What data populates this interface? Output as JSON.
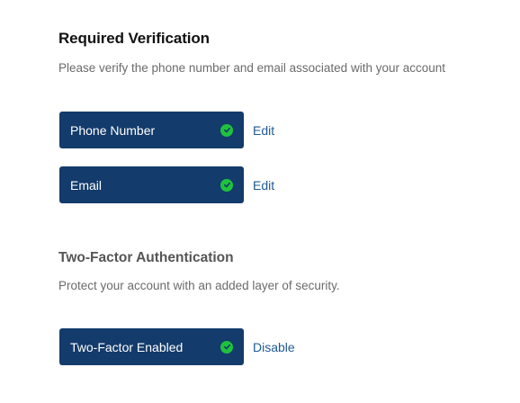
{
  "verification": {
    "title": "Required Verification",
    "subtitle": "Please verify the phone number and email associated with your account",
    "items": [
      {
        "label": "Phone Number",
        "status": "verified",
        "action": "Edit"
      },
      {
        "label": "Email",
        "status": "verified",
        "action": "Edit"
      }
    ]
  },
  "two_factor": {
    "title": "Two-Factor Authentication",
    "subtitle": "Protect your account with an added layer of security.",
    "status_label": "Two-Factor Enabled",
    "status": "enabled",
    "action": "Disable"
  },
  "colors": {
    "button_bg": "#133b6b",
    "check_green": "#1fc23d",
    "link": "#1f5a96"
  },
  "icons": {
    "check": "check-circle-icon"
  }
}
